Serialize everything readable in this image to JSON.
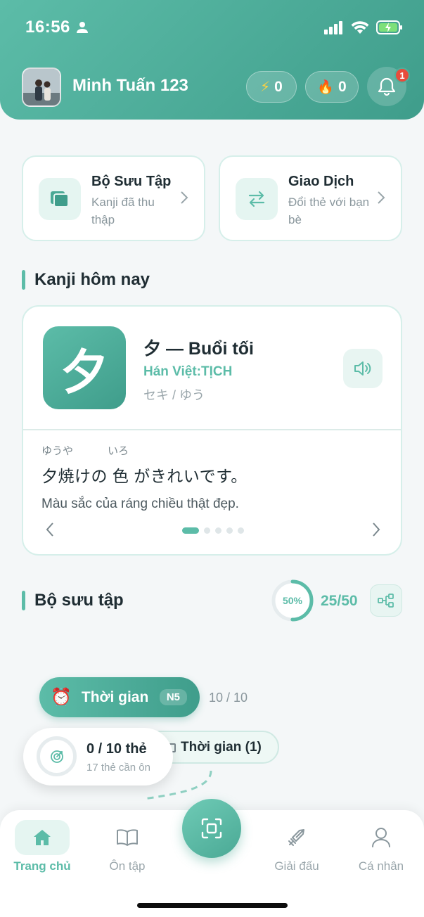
{
  "status_bar": {
    "time": "16:56"
  },
  "header": {
    "username": "Minh Tuấn 123",
    "energy": "0",
    "energy_icon": "⚡",
    "streak": "0",
    "streak_icon": "🔥",
    "notification_count": "1"
  },
  "quick_cards": [
    {
      "title": "Bộ Sưu Tập",
      "subtitle": "Kanji đã thu thập",
      "icon": "cards-icon"
    },
    {
      "title": "Giao Dịch",
      "subtitle": "Đổi thẻ với bạn bè",
      "icon": "swap-icon"
    }
  ],
  "kanji_section": {
    "title": "Kanji hôm nay",
    "kanji": "夕",
    "headline": "夕 — Buổi tối",
    "han_viet": "Hán Việt:TỊCH",
    "reading": "セキ / ゆう",
    "furigana_1": "ゆうや",
    "furigana_2": "いろ",
    "sentence": "夕焼けの 色 がきれいです。",
    "meaning": "Màu sắc của ráng chiều thật đẹp.",
    "page_index": 1,
    "page_count": 5
  },
  "collection": {
    "title": "Bộ sưu tập",
    "percent_label": "50%",
    "percent_value": 0.5,
    "count": "25/50",
    "topic": {
      "emoji": "⏰",
      "label": "Thời gian",
      "level": "N5",
      "progress": "10 / 10"
    },
    "sub_topic": "Thời gian (1)",
    "review": {
      "title": "0 / 10 thẻ",
      "subtitle": "17 thẻ cần ôn"
    }
  },
  "bottom_nav": {
    "home": "Trang chủ",
    "review": "Ôn tập",
    "tournament": "Giải đấu",
    "profile": "Cá nhân"
  },
  "colors": {
    "accent": "#5cbca8",
    "accent_dark": "#3f9d8b",
    "badge": "#e74c3c"
  }
}
